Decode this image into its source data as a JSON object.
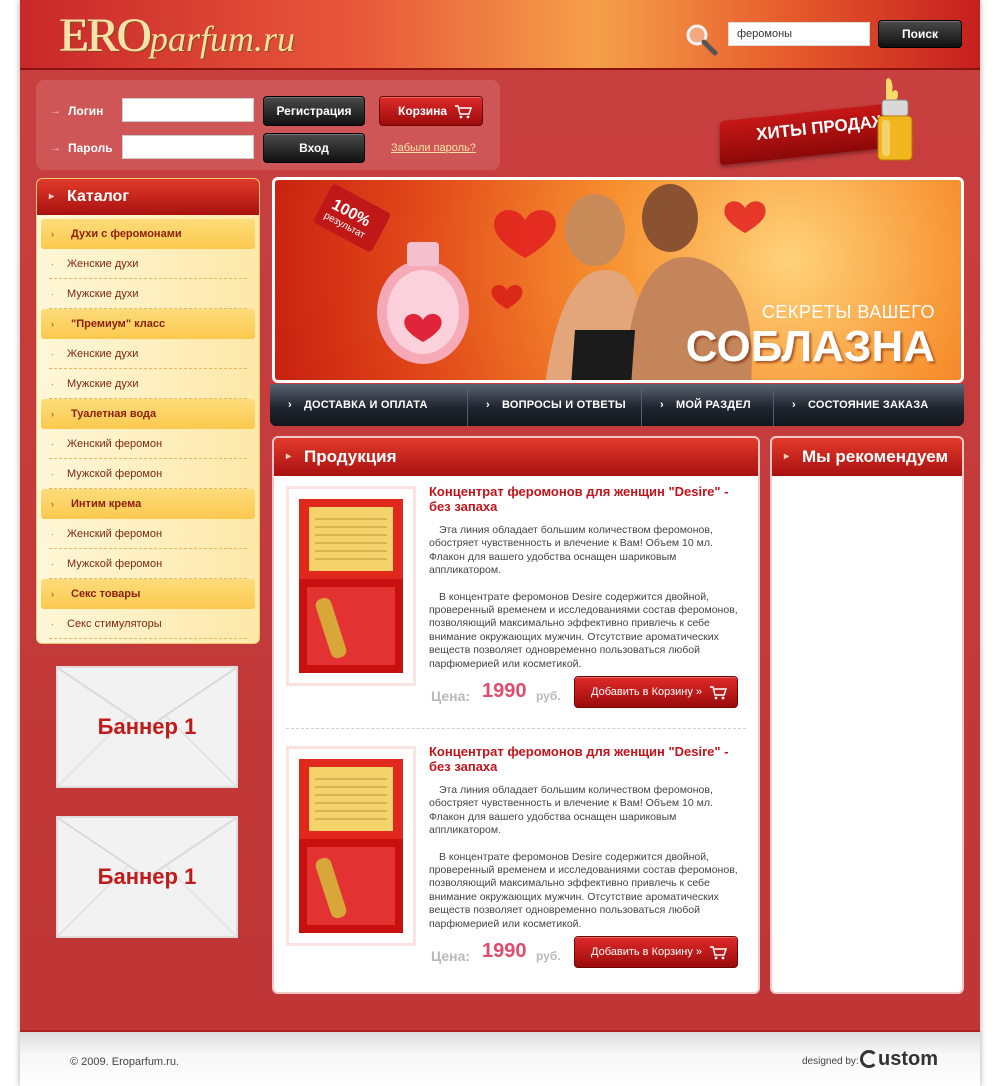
{
  "header": {
    "logo_ero": "ERO",
    "logo_rest": "parfum.ru",
    "search_value": "феромоны",
    "search_button": "Поиск"
  },
  "login": {
    "login_label": "Логин",
    "password_label": "Пароль",
    "register_button": "Регистрация",
    "cart_button": "Корзина",
    "enter_button": "Вход",
    "forgot_link": "Забыли пароль?"
  },
  "hits": {
    "label": "ХИТЫ ПРОДАЖ"
  },
  "catalog": {
    "title": "Каталог",
    "items": [
      {
        "label": "Духи с феромонами",
        "group": true
      },
      {
        "label": "Женские духи",
        "group": false
      },
      {
        "label": "Мужские духи",
        "group": false
      },
      {
        "label": "\"Премиум\" класс",
        "group": true
      },
      {
        "label": "Женские духи",
        "group": false
      },
      {
        "label": "Мужские духи",
        "group": false
      },
      {
        "label": "Туалетная вода",
        "group": true
      },
      {
        "label": "Женский феромон",
        "group": false
      },
      {
        "label": "Мужской феромон",
        "group": false
      },
      {
        "label": "Интим крема",
        "group": true
      },
      {
        "label": "Женский феромон",
        "group": false
      },
      {
        "label": "Мужской феромон",
        "group": false
      },
      {
        "label": "Секс товары",
        "group": true
      },
      {
        "label": "Секс стимуляторы",
        "group": false
      }
    ]
  },
  "banners": [
    {
      "label": "Баннер 1"
    },
    {
      "label": "Баннер 1"
    }
  ],
  "hero": {
    "tag_big": "100%",
    "tag_small": "результат",
    "line1": "СЕКРЕТЫ ВАШЕГО",
    "line2": "СОБЛАЗНА"
  },
  "nav": {
    "items": [
      {
        "label": "ДОСТАВКА И ОПЛАТА"
      },
      {
        "label": "ВОПРОСЫ И ОТВЕТЫ"
      },
      {
        "label": "МОЙ РАЗДЕЛ"
      },
      {
        "label": "СОСТОЯНИЕ ЗАКАЗА"
      }
    ]
  },
  "products": {
    "title": "Продукция",
    "items": [
      {
        "title": "Концентрат феромонов для женщин \"Desire\" - без запаха",
        "desc1": "Эта линия обладает большим количеством феромонов, обостряет чувственность и влечение к Вам! Объем 10 мл. Флакон для вашего удобства оснащен шариковым аппликатором.",
        "desc2": "В концентрате феромонов Desire содержится двойной, проверенный временем и исследованиями состав феромонов, позволяющий максимально эффективно привлечь к себе внимание окружающих мужчин. Отсутствие ароматических веществ позволяет одновременно пользоваться любой парфюмерией или косметикой.",
        "price_label": "Цена:",
        "price": "1990",
        "currency": "руб.",
        "add_button": "Добавить в Корзину »"
      },
      {
        "title": "Концентрат феромонов для женщин \"Desire\" - без запаха",
        "desc1": "Эта линия обладает большим количеством феромонов, обостряет чувственность и влечение к Вам! Объем 10 мл. Флакон для вашего удобства оснащен шариковым аппликатором.",
        "desc2": "В концентрате феромонов Desire содержится двойной, проверенный временем и исследованиями состав феромонов, позволяющий максимально эффективно привлечь к себе внимание окружающих мужчин. Отсутствие ароматических веществ позволяет одновременно пользоваться любой парфюмерией или косметикой.",
        "price_label": "Цена:",
        "price": "1990",
        "currency": "руб.",
        "add_button": "Добавить в Корзину »"
      }
    ]
  },
  "recommend": {
    "title": "Мы рекомендуем"
  },
  "footer": {
    "copyright": "© 2009. Eroparfum.ru.",
    "designed_by": "designed by:",
    "designer_logo": "ustom"
  },
  "colors": {
    "brand_red": "#c0141b",
    "page_bg": "#c63a3a",
    "price_pink": "#e04b6e",
    "catalog_bg": "#fde8a8"
  }
}
